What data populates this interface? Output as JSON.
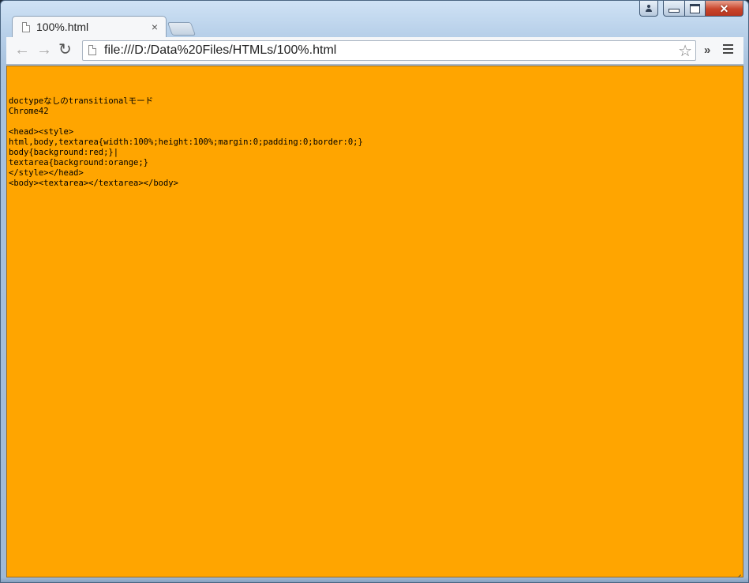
{
  "tab": {
    "title": "100%.html",
    "close": "×"
  },
  "toolbar": {
    "back": "←",
    "forward": "→",
    "reload": "↻",
    "url": "file:///D:/Data%20Files/HTMLs/100%.html",
    "star": "☆",
    "extensions": "»"
  },
  "window_controls": {
    "close": "✕"
  },
  "content": {
    "background": "#ffa500",
    "lines": [
      "",
      "doctypeなしのtransitionalモード",
      "Chrome42",
      "",
      "<head><style>",
      "html,body,textarea{width:100%;height:100%;margin:0;padding:0;border:0;}",
      "body{background:red;}|",
      "textarea{background:orange;}",
      "</style></head>",
      "<body><textarea></textarea></body>"
    ]
  }
}
